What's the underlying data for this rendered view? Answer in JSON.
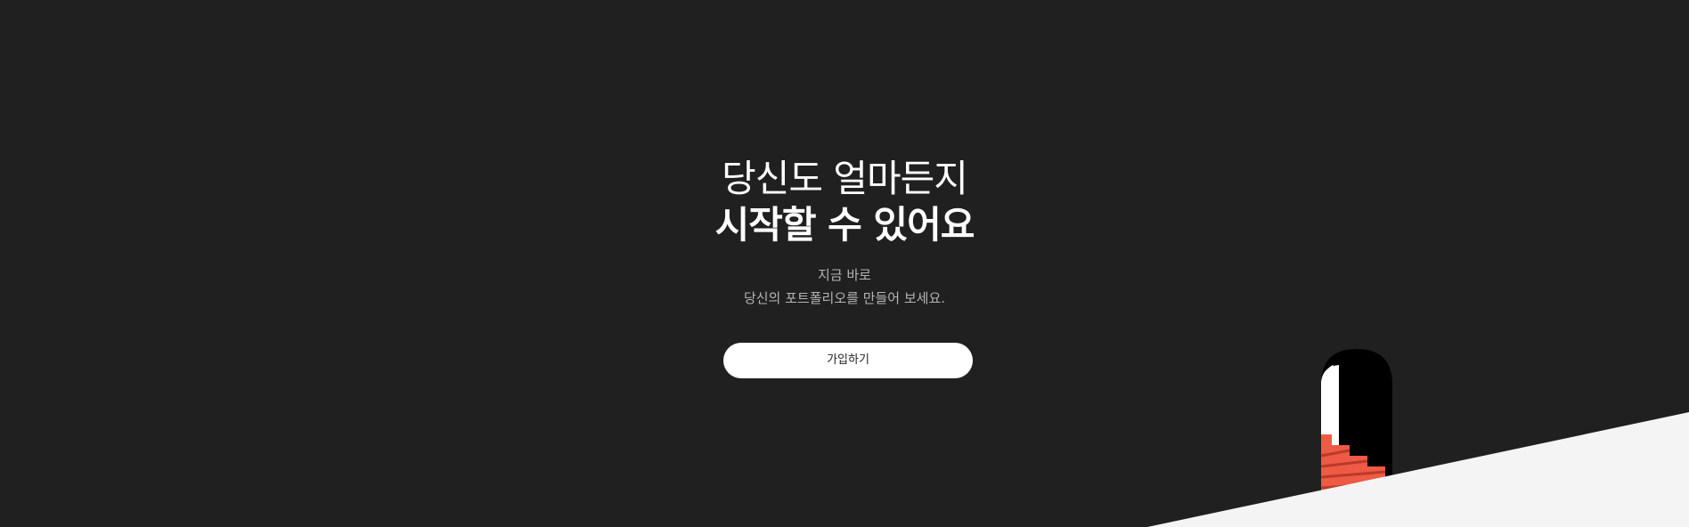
{
  "hero": {
    "title_line1": "당신도 얼마든지",
    "title_line2": "시작할 수 있어요",
    "subtitle_line1": "지금 바로",
    "subtitle_line2": "당신의 포트폴리오를 만들어 보세요.",
    "cta_label": "가입하기"
  },
  "colors": {
    "background": "#202020",
    "ground": "#f4f4f4",
    "door": "#000000",
    "stairs": "#ee5a45"
  },
  "icons": {
    "illustration": "door-with-stairs-illustration"
  }
}
